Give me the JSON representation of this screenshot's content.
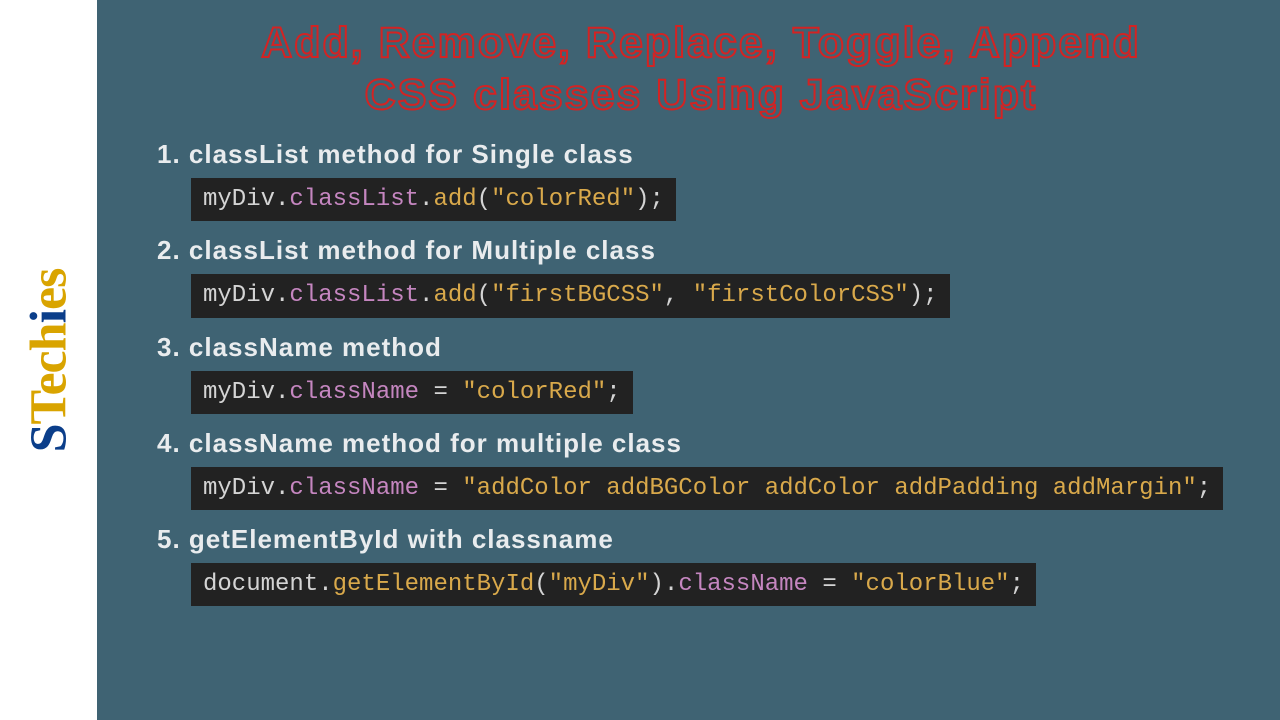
{
  "logo": "STechies",
  "title": {
    "line1": "Add, Remove, Replace, Toggle, Append",
    "line2": "CSS classes Using JavaScript"
  },
  "items": [
    {
      "head": "1. classList method for Single class",
      "code": [
        {
          "t": "myDiv",
          "c": "tk-obj"
        },
        {
          "t": ".",
          "c": "tk-dot"
        },
        {
          "t": "classList",
          "c": "tk-prop"
        },
        {
          "t": ".",
          "c": "tk-dot"
        },
        {
          "t": "add",
          "c": "tk-func"
        },
        {
          "t": "(",
          "c": "tk-paren"
        },
        {
          "t": "\"colorRed\"",
          "c": "tk-str"
        },
        {
          "t": ")",
          "c": "tk-paren"
        },
        {
          "t": ";",
          "c": "tk-semi"
        }
      ]
    },
    {
      "head": "2. classList method for Multiple class",
      "code": [
        {
          "t": "myDiv",
          "c": "tk-obj"
        },
        {
          "t": ".",
          "c": "tk-dot"
        },
        {
          "t": "classList",
          "c": "tk-prop"
        },
        {
          "t": ".",
          "c": "tk-dot"
        },
        {
          "t": "add",
          "c": "tk-func"
        },
        {
          "t": "(",
          "c": "tk-paren"
        },
        {
          "t": "\"firstBGCSS\"",
          "c": "tk-str"
        },
        {
          "t": ", ",
          "c": "tk-comma"
        },
        {
          "t": "\"firstColorCSS\"",
          "c": "tk-str"
        },
        {
          "t": ")",
          "c": "tk-paren"
        },
        {
          "t": ";",
          "c": "tk-semi"
        }
      ]
    },
    {
      "head": "3. className method",
      "code": [
        {
          "t": "myDiv",
          "c": "tk-obj"
        },
        {
          "t": ".",
          "c": "tk-dot"
        },
        {
          "t": "className",
          "c": "tk-prop"
        },
        {
          "t": " = ",
          "c": "tk-op"
        },
        {
          "t": "\"colorRed\"",
          "c": "tk-str"
        },
        {
          "t": ";",
          "c": "tk-semi"
        }
      ]
    },
    {
      "head": "4. className method for multiple class",
      "code": [
        {
          "t": "myDiv",
          "c": "tk-obj"
        },
        {
          "t": ".",
          "c": "tk-dot"
        },
        {
          "t": "className",
          "c": "tk-prop"
        },
        {
          "t": " = ",
          "c": "tk-op"
        },
        {
          "t": "\"addColor addBGColor addColor addPadding addMargin\"",
          "c": "tk-str"
        },
        {
          "t": ";",
          "c": "tk-semi"
        }
      ]
    },
    {
      "head": "5. getElementById with classname",
      "code": [
        {
          "t": "document",
          "c": "tk-obj"
        },
        {
          "t": ".",
          "c": "tk-dot"
        },
        {
          "t": "getElementById",
          "c": "tk-func"
        },
        {
          "t": "(",
          "c": "tk-paren"
        },
        {
          "t": "\"myDiv\"",
          "c": "tk-str"
        },
        {
          "t": ")",
          "c": "tk-paren"
        },
        {
          "t": ".",
          "c": "tk-dot"
        },
        {
          "t": "className",
          "c": "tk-prop"
        },
        {
          "t": " = ",
          "c": "tk-op"
        },
        {
          "t": "\"colorBlue\"",
          "c": "tk-str"
        },
        {
          "t": ";",
          "c": "tk-semi"
        }
      ]
    }
  ]
}
